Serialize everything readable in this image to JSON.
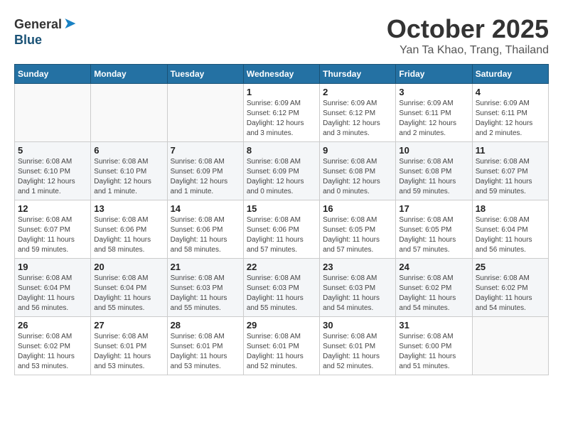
{
  "header": {
    "logo_general": "General",
    "logo_blue": "Blue",
    "month_title": "October 2025",
    "location": "Yan Ta Khao, Trang, Thailand"
  },
  "weekdays": [
    "Sunday",
    "Monday",
    "Tuesday",
    "Wednesday",
    "Thursday",
    "Friday",
    "Saturday"
  ],
  "weeks": [
    [
      {
        "day": "",
        "info": ""
      },
      {
        "day": "",
        "info": ""
      },
      {
        "day": "",
        "info": ""
      },
      {
        "day": "1",
        "info": "Sunrise: 6:09 AM\nSunset: 6:12 PM\nDaylight: 12 hours and 3 minutes."
      },
      {
        "day": "2",
        "info": "Sunrise: 6:09 AM\nSunset: 6:12 PM\nDaylight: 12 hours and 3 minutes."
      },
      {
        "day": "3",
        "info": "Sunrise: 6:09 AM\nSunset: 6:11 PM\nDaylight: 12 hours and 2 minutes."
      },
      {
        "day": "4",
        "info": "Sunrise: 6:09 AM\nSunset: 6:11 PM\nDaylight: 12 hours and 2 minutes."
      }
    ],
    [
      {
        "day": "5",
        "info": "Sunrise: 6:08 AM\nSunset: 6:10 PM\nDaylight: 12 hours and 1 minute."
      },
      {
        "day": "6",
        "info": "Sunrise: 6:08 AM\nSunset: 6:10 PM\nDaylight: 12 hours and 1 minute."
      },
      {
        "day": "7",
        "info": "Sunrise: 6:08 AM\nSunset: 6:09 PM\nDaylight: 12 hours and 1 minute."
      },
      {
        "day": "8",
        "info": "Sunrise: 6:08 AM\nSunset: 6:09 PM\nDaylight: 12 hours and 0 minutes."
      },
      {
        "day": "9",
        "info": "Sunrise: 6:08 AM\nSunset: 6:08 PM\nDaylight: 12 hours and 0 minutes."
      },
      {
        "day": "10",
        "info": "Sunrise: 6:08 AM\nSunset: 6:08 PM\nDaylight: 11 hours and 59 minutes."
      },
      {
        "day": "11",
        "info": "Sunrise: 6:08 AM\nSunset: 6:07 PM\nDaylight: 11 hours and 59 minutes."
      }
    ],
    [
      {
        "day": "12",
        "info": "Sunrise: 6:08 AM\nSunset: 6:07 PM\nDaylight: 11 hours and 59 minutes."
      },
      {
        "day": "13",
        "info": "Sunrise: 6:08 AM\nSunset: 6:06 PM\nDaylight: 11 hours and 58 minutes."
      },
      {
        "day": "14",
        "info": "Sunrise: 6:08 AM\nSunset: 6:06 PM\nDaylight: 11 hours and 58 minutes."
      },
      {
        "day": "15",
        "info": "Sunrise: 6:08 AM\nSunset: 6:06 PM\nDaylight: 11 hours and 57 minutes."
      },
      {
        "day": "16",
        "info": "Sunrise: 6:08 AM\nSunset: 6:05 PM\nDaylight: 11 hours and 57 minutes."
      },
      {
        "day": "17",
        "info": "Sunrise: 6:08 AM\nSunset: 6:05 PM\nDaylight: 11 hours and 57 minutes."
      },
      {
        "day": "18",
        "info": "Sunrise: 6:08 AM\nSunset: 6:04 PM\nDaylight: 11 hours and 56 minutes."
      }
    ],
    [
      {
        "day": "19",
        "info": "Sunrise: 6:08 AM\nSunset: 6:04 PM\nDaylight: 11 hours and 56 minutes."
      },
      {
        "day": "20",
        "info": "Sunrise: 6:08 AM\nSunset: 6:04 PM\nDaylight: 11 hours and 55 minutes."
      },
      {
        "day": "21",
        "info": "Sunrise: 6:08 AM\nSunset: 6:03 PM\nDaylight: 11 hours and 55 minutes."
      },
      {
        "day": "22",
        "info": "Sunrise: 6:08 AM\nSunset: 6:03 PM\nDaylight: 11 hours and 55 minutes."
      },
      {
        "day": "23",
        "info": "Sunrise: 6:08 AM\nSunset: 6:03 PM\nDaylight: 11 hours and 54 minutes."
      },
      {
        "day": "24",
        "info": "Sunrise: 6:08 AM\nSunset: 6:02 PM\nDaylight: 11 hours and 54 minutes."
      },
      {
        "day": "25",
        "info": "Sunrise: 6:08 AM\nSunset: 6:02 PM\nDaylight: 11 hours and 54 minutes."
      }
    ],
    [
      {
        "day": "26",
        "info": "Sunrise: 6:08 AM\nSunset: 6:02 PM\nDaylight: 11 hours and 53 minutes."
      },
      {
        "day": "27",
        "info": "Sunrise: 6:08 AM\nSunset: 6:01 PM\nDaylight: 11 hours and 53 minutes."
      },
      {
        "day": "28",
        "info": "Sunrise: 6:08 AM\nSunset: 6:01 PM\nDaylight: 11 hours and 53 minutes."
      },
      {
        "day": "29",
        "info": "Sunrise: 6:08 AM\nSunset: 6:01 PM\nDaylight: 11 hours and 52 minutes."
      },
      {
        "day": "30",
        "info": "Sunrise: 6:08 AM\nSunset: 6:01 PM\nDaylight: 11 hours and 52 minutes."
      },
      {
        "day": "31",
        "info": "Sunrise: 6:08 AM\nSunset: 6:00 PM\nDaylight: 11 hours and 51 minutes."
      },
      {
        "day": "",
        "info": ""
      }
    ]
  ]
}
